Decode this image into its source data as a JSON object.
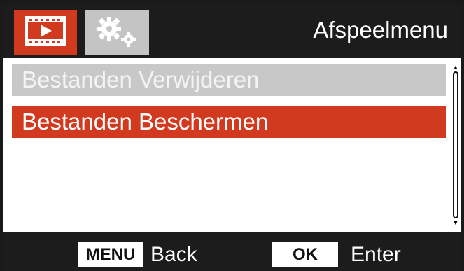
{
  "header": {
    "title": "Afspeelmenu",
    "tabs": [
      {
        "name": "playback",
        "icon": "play-icon",
        "active": true
      },
      {
        "name": "settings",
        "icon": "gears-icon",
        "active": false
      }
    ]
  },
  "menu": {
    "items": [
      {
        "label": "Bestanden Verwijderen",
        "selected": false
      },
      {
        "label": "Bestanden Beschermen",
        "selected": true
      }
    ]
  },
  "footer": {
    "menu_key": "MENU",
    "menu_action": "Back",
    "ok_key": "OK",
    "ok_action": "Enter"
  },
  "colors": {
    "accent": "#d23a20",
    "header_bg": "#1c1c1c",
    "inactive_item": "#c8c8c8",
    "inactive_tab": "#c4c4c4"
  }
}
